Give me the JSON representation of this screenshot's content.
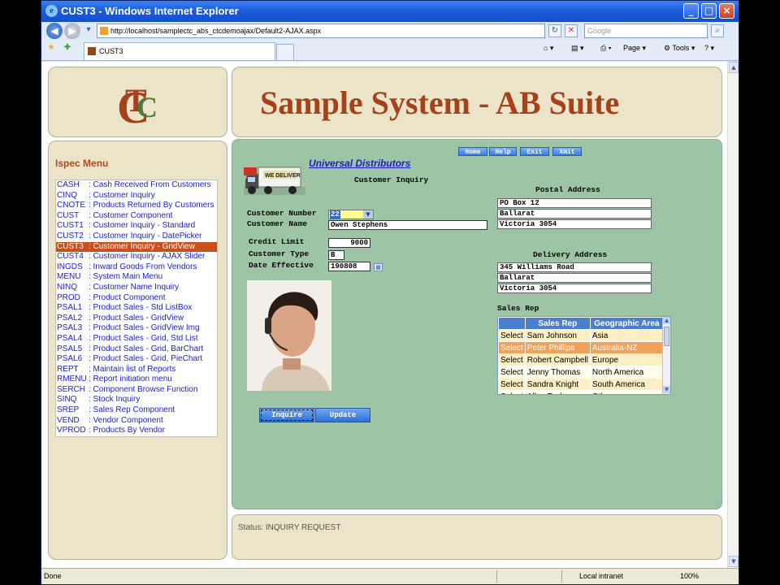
{
  "browser": {
    "title": "CUST3 - Windows Internet Explorer",
    "url": "http://localhost/samplectc_abs_ctcdemoajax/Default2-AJAX.aspx",
    "search_placeholder": "Google",
    "tab_title": "CUST3",
    "page_label": "Page",
    "tools_label": "Tools",
    "status_done": "Done",
    "zone": "Local intranet",
    "zoom": "100%"
  },
  "header": {
    "logo_letters": "CTC",
    "system_title": "Sample System - AB Suite"
  },
  "ispec_menu": {
    "title": "Ispec Menu",
    "items": [
      {
        "code": "CASH",
        "label": ": Cash Received From Customers"
      },
      {
        "code": "CINQ",
        "label": ": Customer Inquiry"
      },
      {
        "code": "CNOTE",
        "label": ": Products Returned By Customers"
      },
      {
        "code": "CUST",
        "label": ": Customer Component"
      },
      {
        "code": "CUST1",
        "label": ": Customer Inquiry - Standard"
      },
      {
        "code": "CUST2",
        "label": ": Customer Inquiry - DatePicker"
      },
      {
        "code": "CUST3",
        "label": ": Customer Inquiry - GridView"
      },
      {
        "code": "CUST4",
        "label": ": Customer Inquiry - AJAX Slider"
      },
      {
        "code": "INGDS",
        "label": ": Inward Goods From Vendors"
      },
      {
        "code": "MENU",
        "label": ": System Main Menu"
      },
      {
        "code": "NINQ",
        "label": ": Customer Name Inquiry"
      },
      {
        "code": "PROD",
        "label": ": Product Component"
      },
      {
        "code": "PSAL1",
        "label": ": Product Sales - Std ListBox"
      },
      {
        "code": "PSAL2",
        "label": ": Product Sales - GridView"
      },
      {
        "code": "PSAL3",
        "label": ": Product Sales - GridView Img"
      },
      {
        "code": "PSAL4",
        "label": ": Product Sales - Grid, Std List"
      },
      {
        "code": "PSAL5",
        "label": ": Product Sales - Grid, BarChart"
      },
      {
        "code": "PSAL6",
        "label": ": Product Sales - Grid, PieChart"
      },
      {
        "code": "REPT",
        "label": ": Maintain list of Reports"
      },
      {
        "code": "RMENU",
        "label": ": Report initiation menu"
      },
      {
        "code": "SERCH",
        "label": ": Component Browse Function"
      },
      {
        "code": "SINQ",
        "label": ": Stock Inquiry"
      },
      {
        "code": "SREP",
        "label": ": Sales Rep Component"
      },
      {
        "code": "VEND",
        "label": ": Vendor Component"
      },
      {
        "code": "VPROD",
        "label": ": Products By Vendor"
      }
    ],
    "selected_index": 6
  },
  "nav": {
    "home": "Home",
    "help": "Help",
    "exit": "Exit",
    "xmit": "Xmit"
  },
  "form": {
    "company": "Universal Distributors",
    "truck_sign": "WE DELIVER",
    "heading": "Customer Inquiry",
    "customer_number_label": "Customer Number",
    "customer_number": "22",
    "customer_name_label": "Customer Name",
    "customer_name": "Owen Stephens",
    "credit_limit_label": "Credit Limit",
    "credit_limit": "9000",
    "customer_type_label": "Customer Type",
    "customer_type": "B",
    "date_effective_label": "Date Effective",
    "date_effective": "190808",
    "inquire": "Inquire",
    "update": "Update"
  },
  "postal_address": {
    "title": "Postal Address",
    "lines": [
      "PO Box 12",
      "Ballarat",
      "Victoria 3054"
    ]
  },
  "delivery_address": {
    "title": "Delivery Address",
    "lines": [
      "345 Williams Road",
      "Ballarat",
      "Victoria 3054"
    ]
  },
  "sales_rep": {
    "title": "Sales Rep",
    "columns": [
      "",
      "Sales Rep",
      "Geographic Area"
    ],
    "select_label": "Select",
    "rows": [
      {
        "name": "Sam Johnson",
        "area": "Asia"
      },
      {
        "name": "Peter Phillips",
        "area": "Australia-NZ"
      },
      {
        "name": "Robert Campbell",
        "area": "Europe"
      },
      {
        "name": "Jenny Thomas",
        "area": "North America"
      },
      {
        "name": "Sandra Knight",
        "area": "South America"
      },
      {
        "name": "Allen Taylor",
        "area": "Other"
      }
    ],
    "selected_index": 1
  },
  "status": {
    "text": "Status: INQUIRY REQUEST"
  },
  "colors": {
    "brand": "#a3421b",
    "content_bg": "#9ec4a6",
    "panel_bg": "#ebe4c8",
    "menu_selected": "#c8501e",
    "link": "#1c1ccc"
  }
}
